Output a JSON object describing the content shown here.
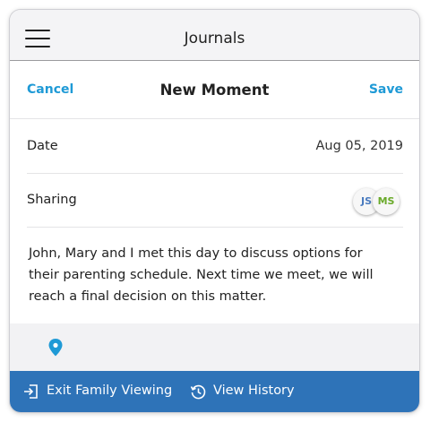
{
  "header": {
    "title": "Journals",
    "menu_icon": "hamburger-icon"
  },
  "sheet": {
    "cancel_label": "Cancel",
    "title": "New Moment",
    "save_label": "Save"
  },
  "fields": {
    "date": {
      "label": "Date",
      "value": "Aug 05, 2019"
    },
    "sharing": {
      "label": "Sharing",
      "avatars": [
        {
          "initials": "JS"
        },
        {
          "initials": "MS"
        }
      ]
    }
  },
  "note_text": "John, Mary and I met this day to discuss options for their parenting schedule. Next time we meet, we will reach a final decision on this matter.",
  "toolbar": {
    "location_icon": "map-pin-icon"
  },
  "bottom_bar": {
    "exit_label": "Exit Family Viewing",
    "exit_icon": "exit-icon",
    "history_label": "View History",
    "history_icon": "history-icon"
  },
  "colors": {
    "accent": "#1f9ad6",
    "bottom_bar": "#2e73b8",
    "avatar_js": "#4a7bbf",
    "avatar_ms": "#6aaa2a"
  }
}
